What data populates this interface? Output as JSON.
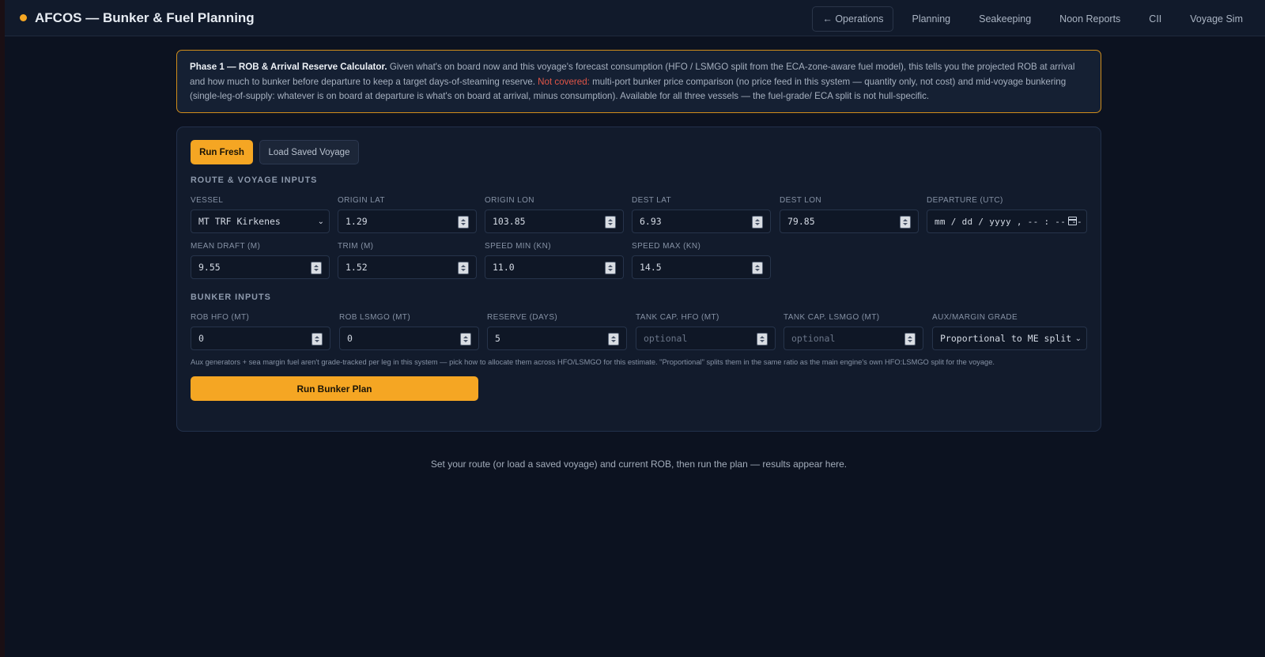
{
  "header": {
    "title": "AFCOS — Bunker & Fuel Planning",
    "nav": [
      "← Operations",
      "Planning",
      "Seakeeping",
      "Noon Reports",
      "CII",
      "Voyage Sim"
    ]
  },
  "notice": {
    "bold": "Phase 1 — ROB & Arrival Reserve Calculator.",
    "text1": " Given what's on board now and this voyage's forecast consumption (HFO / LSMGO split from the ECA-zone-aware fuel model), this tells you the projected ROB at arrival and how much to bunker before departure to keep a target days-of-steaming reserve. ",
    "warn": "Not covered:",
    "text2": " multi-port bunker price comparison (no price feed in this system — quantity only, not cost) and mid-voyage bunkering (single-leg-of-supply: whatever is on board at departure is what's on board at arrival, minus consumption). Available for all three vessels — the fuel-grade/ ECA split is not hull-specific."
  },
  "tabs": {
    "run_fresh": "Run Fresh",
    "load_saved": "Load Saved Voyage"
  },
  "route": {
    "section_title": "ROUTE & VOYAGE INPUTS",
    "vessel": {
      "label": "VESSEL",
      "value": "MT TRF Kirkenes"
    },
    "origin_lat": {
      "label": "ORIGIN LAT",
      "value": "1.29"
    },
    "origin_lon": {
      "label": "ORIGIN LON",
      "value": "103.85"
    },
    "dest_lat": {
      "label": "DEST LAT",
      "value": "6.93"
    },
    "dest_lon": {
      "label": "DEST LON",
      "value": "79.85"
    },
    "departure": {
      "label": "DEPARTURE (UTC)",
      "value": "mm / dd / yyyy ,  -- : --  --"
    },
    "mean_draft": {
      "label": "MEAN DRAFT (M)",
      "value": "9.55"
    },
    "trim": {
      "label": "TRIM (M)",
      "value": "1.52"
    },
    "speed_min": {
      "label": "SPEED MIN (KN)",
      "value": "11.0"
    },
    "speed_max": {
      "label": "SPEED MAX (KN)",
      "value": "14.5"
    }
  },
  "bunker": {
    "section_title": "BUNKER INPUTS",
    "rob_hfo": {
      "label": "ROB HFO (MT)",
      "value": "0"
    },
    "rob_lsmgo": {
      "label": "ROB LSMGO (MT)",
      "value": "0"
    },
    "reserve": {
      "label": "RESERVE (DAYS)",
      "value": "5"
    },
    "tank_hfo": {
      "label": "TANK CAP. HFO (MT)",
      "placeholder": "optional"
    },
    "tank_lsmgo": {
      "label": "TANK CAP. LSMGO (MT)",
      "placeholder": "optional"
    },
    "aux_grade": {
      "label": "AUX/MARGIN GRADE",
      "value": "Proportional to ME split"
    },
    "hint": "Aux generators + sea margin fuel aren't grade-tracked per leg in this system — pick how to allocate them across HFO/LSMGO for this estimate. \"Proportional\" splits them in the same ratio as the main engine's own HFO:LSMGO split for the voyage.",
    "run_button": "Run Bunker Plan"
  },
  "empty_state": "Set your route (or load a saved voyage) and current ROB, then run the plan — results appear here.",
  "colors": {
    "accent": "#f5a623",
    "warning": "#e05547",
    "background": "#0c1220"
  }
}
